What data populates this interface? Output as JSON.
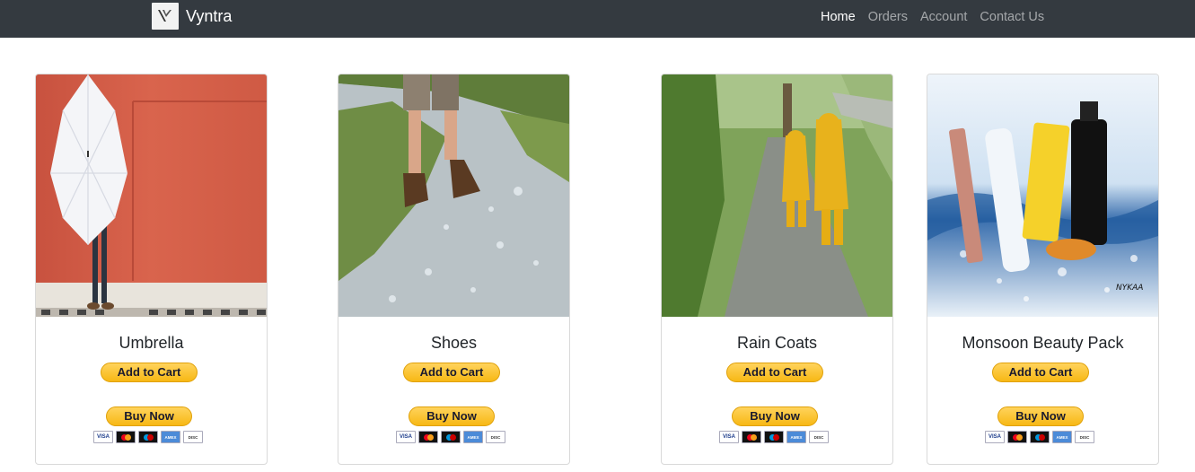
{
  "navbar": {
    "brand": "Vyntra",
    "links": [
      "Home",
      "Orders",
      "Account",
      "Contact Us"
    ],
    "active": "Home"
  },
  "products": [
    {
      "title": "Umbrella",
      "image": "umbrella-photo",
      "add_to_cart": "Add to Cart",
      "buy_now": "Buy Now"
    },
    {
      "title": "Shoes",
      "image": "hiking-boots-photo",
      "add_to_cart": "Add to Cart",
      "buy_now": "Buy Now"
    },
    {
      "title": "Rain Coats",
      "image": "rain-coats-photo",
      "add_to_cart": "Add to Cart",
      "buy_now": "Buy Now"
    },
    {
      "title": "Monsoon Beauty Pack",
      "image": "beauty-products-photo",
      "add_to_cart": "Add to Cart",
      "buy_now": "Buy Now"
    }
  ],
  "payment_icons": [
    "visa-icon",
    "mastercard-icon",
    "maestro-icon",
    "amex-icon",
    "discover-icon"
  ],
  "colors": {
    "navbar_bg": "#343a40",
    "paypal_button": "#ffc439"
  }
}
